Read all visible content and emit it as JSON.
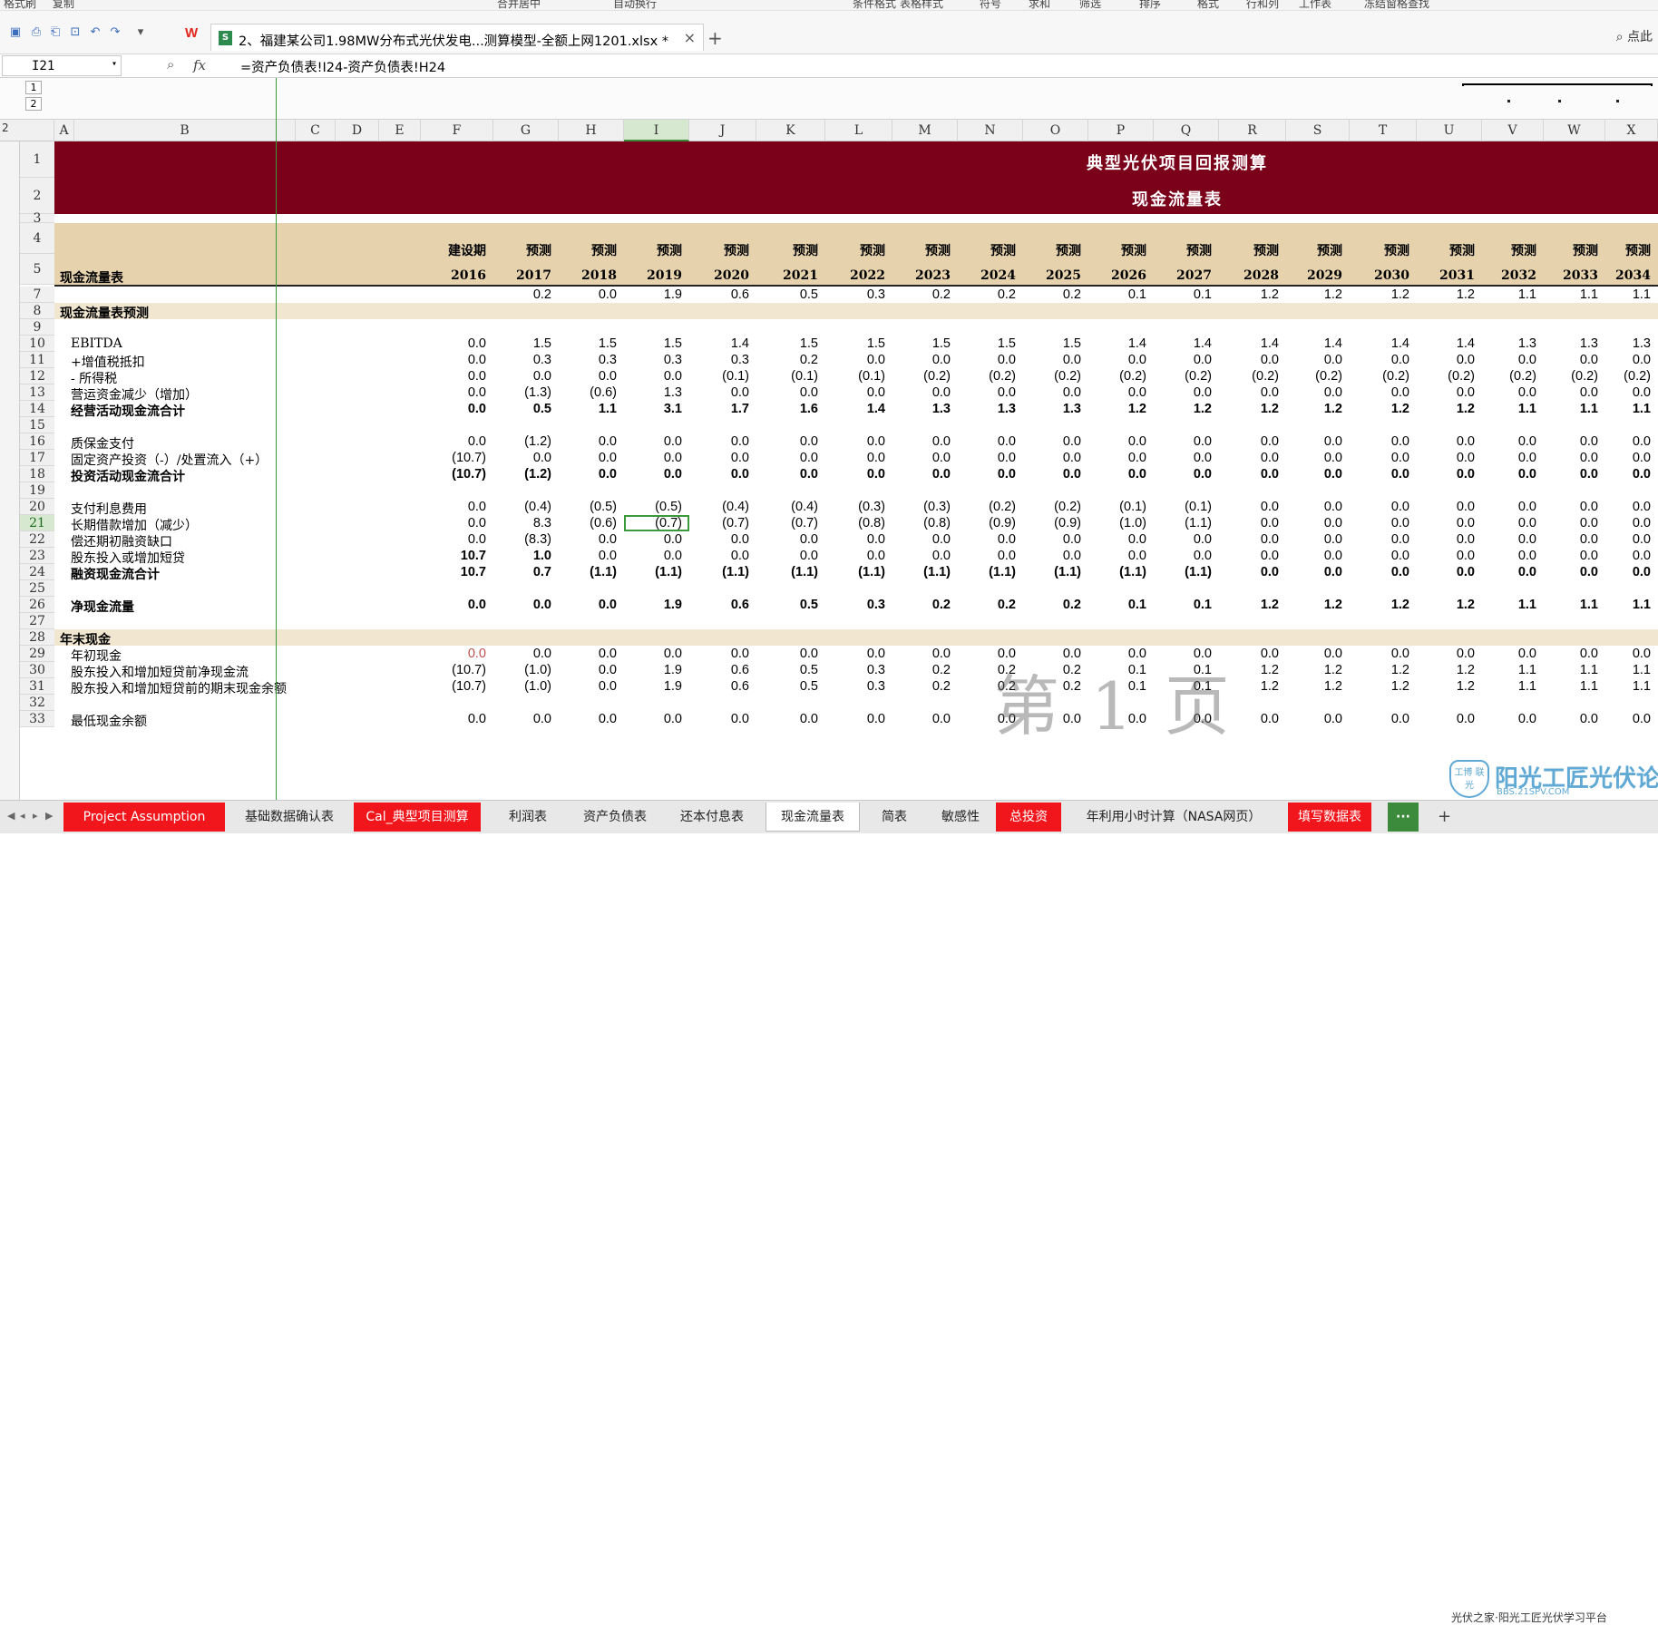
{
  "ribbon": [
    "格式刷",
    "复制",
    "合并居中",
    "自动换行",
    "条件格式",
    "表格样式",
    "符号",
    "求和",
    "筛选",
    "排序",
    "格式",
    "行和列",
    "工作表",
    "冻结窗格",
    "查找"
  ],
  "doc_tab": {
    "title": "2、福建某公司1.98MW分布式光伏发电...测算模型-全额上网1201.xlsx *",
    "close": "×"
  },
  "right_label": "点此",
  "name_box": "I21",
  "fx": "fx",
  "formula": "=资产负债表!I24-资产负债表!H24",
  "group_levels": [
    "1",
    "2"
  ],
  "row_level_label": "2",
  "columns": [
    "A",
    "B",
    "C",
    "D",
    "E",
    "F",
    "G",
    "H",
    "I",
    "J",
    "K",
    "L",
    "M",
    "N",
    "O",
    "P",
    "Q",
    "R",
    "S",
    "T",
    "U",
    "V",
    "W",
    "X"
  ],
  "title1": "典型光伏项目回报测算",
  "title2": "现金流量表",
  "header": {
    "row4_first": "建设期",
    "row4_rest": "预测",
    "row5_label": "现金流量表",
    "years": [
      "2016",
      "2017",
      "2018",
      "2019",
      "2020",
      "2021",
      "2022",
      "2023",
      "2024",
      "2025",
      "2026",
      "2027",
      "2028",
      "2029",
      "2030",
      "2031",
      "2032",
      "2033",
      "2034"
    ]
  },
  "rows": [
    {
      "num": "7",
      "label": "",
      "bold": false,
      "values": [
        "",
        "0.2",
        "0.0",
        "1.9",
        "0.6",
        "0.5",
        "0.3",
        "0.2",
        "0.2",
        "0.2",
        "0.1",
        "0.1",
        "1.2",
        "1.2",
        "1.2",
        "1.2",
        "1.1",
        "1.1",
        "1.1"
      ]
    },
    {
      "num": "8",
      "label": "现金流量表预测",
      "bold": true,
      "section": true,
      "values": []
    },
    {
      "num": "9",
      "label": "",
      "values": []
    },
    {
      "num": "10",
      "label": "EBITDA",
      "indent": true,
      "values": [
        "0.0",
        "1.5",
        "1.5",
        "1.5",
        "1.4",
        "1.5",
        "1.5",
        "1.5",
        "1.5",
        "1.5",
        "1.4",
        "1.4",
        "1.4",
        "1.4",
        "1.4",
        "1.4",
        "1.3",
        "1.3",
        "1.3"
      ]
    },
    {
      "num": "11",
      "label": "+增值税抵扣",
      "indent": true,
      "values": [
        "0.0",
        "0.3",
        "0.3",
        "0.3",
        "0.3",
        "0.2",
        "0.0",
        "0.0",
        "0.0",
        "0.0",
        "0.0",
        "0.0",
        "0.0",
        "0.0",
        "0.0",
        "0.0",
        "0.0",
        "0.0",
        "0.0"
      ]
    },
    {
      "num": "12",
      "label": "- 所得税",
      "indent": true,
      "values": [
        "0.0",
        "0.0",
        "0.0",
        "0.0",
        "(0.1)",
        "(0.1)",
        "(0.1)",
        "(0.2)",
        "(0.2)",
        "(0.2)",
        "(0.2)",
        "(0.2)",
        "(0.2)",
        "(0.2)",
        "(0.2)",
        "(0.2)",
        "(0.2)",
        "(0.2)",
        "(0.2)"
      ]
    },
    {
      "num": "13",
      "label": "营运资金减少（增加）",
      "indent": true,
      "values": [
        "0.0",
        "(1.3)",
        "(0.6)",
        "1.3",
        "0.0",
        "0.0",
        "0.0",
        "0.0",
        "0.0",
        "0.0",
        "0.0",
        "0.0",
        "0.0",
        "0.0",
        "0.0",
        "0.0",
        "0.0",
        "0.0",
        "0.0"
      ]
    },
    {
      "num": "14",
      "label": "经营活动现金流合计",
      "indent": true,
      "bold": true,
      "values": [
        "0.0",
        "0.5",
        "1.1",
        "3.1",
        "1.7",
        "1.6",
        "1.4",
        "1.3",
        "1.3",
        "1.3",
        "1.2",
        "1.2",
        "1.2",
        "1.2",
        "1.2",
        "1.2",
        "1.1",
        "1.1",
        "1.1"
      ]
    },
    {
      "num": "15",
      "label": "",
      "values": []
    },
    {
      "num": "16",
      "label": "质保金支付",
      "indent": true,
      "values": [
        "0.0",
        "(1.2)",
        "0.0",
        "0.0",
        "0.0",
        "0.0",
        "0.0",
        "0.0",
        "0.0",
        "0.0",
        "0.0",
        "0.0",
        "0.0",
        "0.0",
        "0.0",
        "0.0",
        "0.0",
        "0.0",
        "0.0"
      ]
    },
    {
      "num": "17",
      "label": "固定资产投资（-）/处置流入（+）",
      "indent": true,
      "values": [
        "(10.7)",
        "0.0",
        "0.0",
        "0.0",
        "0.0",
        "0.0",
        "0.0",
        "0.0",
        "0.0",
        "0.0",
        "0.0",
        "0.0",
        "0.0",
        "0.0",
        "0.0",
        "0.0",
        "0.0",
        "0.0",
        "0.0"
      ]
    },
    {
      "num": "18",
      "label": "投资活动现金流合计",
      "indent": true,
      "bold": true,
      "values": [
        "(10.7)",
        "(1.2)",
        "0.0",
        "0.0",
        "0.0",
        "0.0",
        "0.0",
        "0.0",
        "0.0",
        "0.0",
        "0.0",
        "0.0",
        "0.0",
        "0.0",
        "0.0",
        "0.0",
        "0.0",
        "0.0",
        "0.0"
      ]
    },
    {
      "num": "19",
      "label": "",
      "values": []
    },
    {
      "num": "20",
      "label": "支付利息费用",
      "indent": true,
      "values": [
        "0.0",
        "(0.4)",
        "(0.5)",
        "(0.5)",
        "(0.4)",
        "(0.4)",
        "(0.3)",
        "(0.3)",
        "(0.2)",
        "(0.2)",
        "(0.1)",
        "(0.1)",
        "0.0",
        "0.0",
        "0.0",
        "0.0",
        "0.0",
        "0.0",
        "0.0"
      ]
    },
    {
      "num": "21",
      "label": "长期借款增加（减少）",
      "indent": true,
      "values": [
        "0.0",
        "8.3",
        "(0.6)",
        "(0.7)",
        "(0.7)",
        "(0.7)",
        "(0.8)",
        "(0.8)",
        "(0.9)",
        "(0.9)",
        "(1.0)",
        "(1.1)",
        "0.0",
        "0.0",
        "0.0",
        "0.0",
        "0.0",
        "0.0",
        "0.0"
      ]
    },
    {
      "num": "22",
      "label": "偿还期初融资缺口",
      "indent": true,
      "values": [
        "0.0",
        "(8.3)",
        "0.0",
        "0.0",
        "0.0",
        "0.0",
        "0.0",
        "0.0",
        "0.0",
        "0.0",
        "0.0",
        "0.0",
        "0.0",
        "0.0",
        "0.0",
        "0.0",
        "0.0",
        "0.0",
        "0.0"
      ]
    },
    {
      "num": "23",
      "label": "股东投入或增加短贷",
      "indent": true,
      "boldvals": true,
      "values": [
        "10.7",
        "1.0",
        "0.0",
        "0.0",
        "0.0",
        "0.0",
        "0.0",
        "0.0",
        "0.0",
        "0.0",
        "0.0",
        "0.0",
        "0.0",
        "0.0",
        "0.0",
        "0.0",
        "0.0",
        "0.0",
        "0.0"
      ]
    },
    {
      "num": "24",
      "label": "融资现金流合计",
      "indent": true,
      "bold": true,
      "values": [
        "10.7",
        "0.7",
        "(1.1)",
        "(1.1)",
        "(1.1)",
        "(1.1)",
        "(1.1)",
        "(1.1)",
        "(1.1)",
        "(1.1)",
        "(1.1)",
        "(1.1)",
        "0.0",
        "0.0",
        "0.0",
        "0.0",
        "0.0",
        "0.0",
        "0.0"
      ]
    },
    {
      "num": "25",
      "label": "",
      "values": []
    },
    {
      "num": "26",
      "label": "净现金流量",
      "indent": true,
      "bold": true,
      "values": [
        "0.0",
        "0.0",
        "0.0",
        "1.9",
        "0.6",
        "0.5",
        "0.3",
        "0.2",
        "0.2",
        "0.2",
        "0.1",
        "0.1",
        "1.2",
        "1.2",
        "1.2",
        "1.2",
        "1.1",
        "1.1",
        "1.1"
      ]
    },
    {
      "num": "27",
      "label": "",
      "values": []
    },
    {
      "num": "28",
      "label": "年末现金",
      "bold": true,
      "section": true,
      "values": []
    },
    {
      "num": "29",
      "label": "年初现金",
      "indent": true,
      "redfirst": true,
      "values": [
        "0.0",
        "0.0",
        "0.0",
        "0.0",
        "0.0",
        "0.0",
        "0.0",
        "0.0",
        "0.0",
        "0.0",
        "0.0",
        "0.0",
        "0.0",
        "0.0",
        "0.0",
        "0.0",
        "0.0",
        "0.0",
        "0.0"
      ]
    },
    {
      "num": "30",
      "label": "股东投入和增加短贷前净现金流",
      "indent": true,
      "values": [
        "(10.7)",
        "(1.0)",
        "0.0",
        "1.9",
        "0.6",
        "0.5",
        "0.3",
        "0.2",
        "0.2",
        "0.2",
        "0.1",
        "0.1",
        "1.2",
        "1.2",
        "1.2",
        "1.2",
        "1.1",
        "1.1",
        "1.1"
      ]
    },
    {
      "num": "31",
      "label": "股东投入和增加短贷前的期末现金余额",
      "indent": true,
      "values": [
        "(10.7)",
        "(1.0)",
        "0.0",
        "1.9",
        "0.6",
        "0.5",
        "0.3",
        "0.2",
        "0.2",
        "0.2",
        "0.1",
        "0.1",
        "1.2",
        "1.2",
        "1.2",
        "1.2",
        "1.1",
        "1.1",
        "1.1"
      ]
    },
    {
      "num": "32",
      "label": "",
      "values": []
    },
    {
      "num": "33",
      "label": "最低现金余额",
      "indent": true,
      "values": [
        "0.0",
        "0.0",
        "0.0",
        "0.0",
        "0.0",
        "0.0",
        "0.0",
        "0.0",
        "0.0",
        "0.0",
        "0.0",
        "0.0",
        "0.0",
        "0.0",
        "0.0",
        "0.0",
        "0.0",
        "0.0",
        "0.0"
      ]
    }
  ],
  "watermark": "第 1 页",
  "sheet_tabs": [
    {
      "label": "Project Assumption",
      "style": "red"
    },
    {
      "label": "基础数据确认表",
      "style": "plain"
    },
    {
      "label": "Cal_典型项目测算",
      "style": "red"
    },
    {
      "label": "利润表",
      "style": "plain"
    },
    {
      "label": "资产负债表",
      "style": "plain"
    },
    {
      "label": "还本付息表",
      "style": "plain"
    },
    {
      "label": "现金流量表",
      "style": "active"
    },
    {
      "label": "简表",
      "style": "plain"
    },
    {
      "label": "敏感性",
      "style": "plain"
    },
    {
      "label": "总投资",
      "style": "red"
    },
    {
      "label": "年利用小时计算（NASA网页）",
      "style": "plain"
    },
    {
      "label": "填写数据表",
      "style": "red"
    },
    {
      "label": "···",
      "style": "green"
    }
  ],
  "add_tab": "+",
  "site_logo": {
    "shield": "工博 联光",
    "title": "阳光工匠光伏论坛",
    "url": "BBS.21SPV.COM",
    "note": "光伏之家·阳光工匠光伏学习平台"
  },
  "colors": {
    "title_band": "#7b0019",
    "header_band": "#e6d3ae",
    "section_band": "#f1e6cf",
    "selection": "#3a9a3a",
    "tab_red": "#f0161c"
  }
}
